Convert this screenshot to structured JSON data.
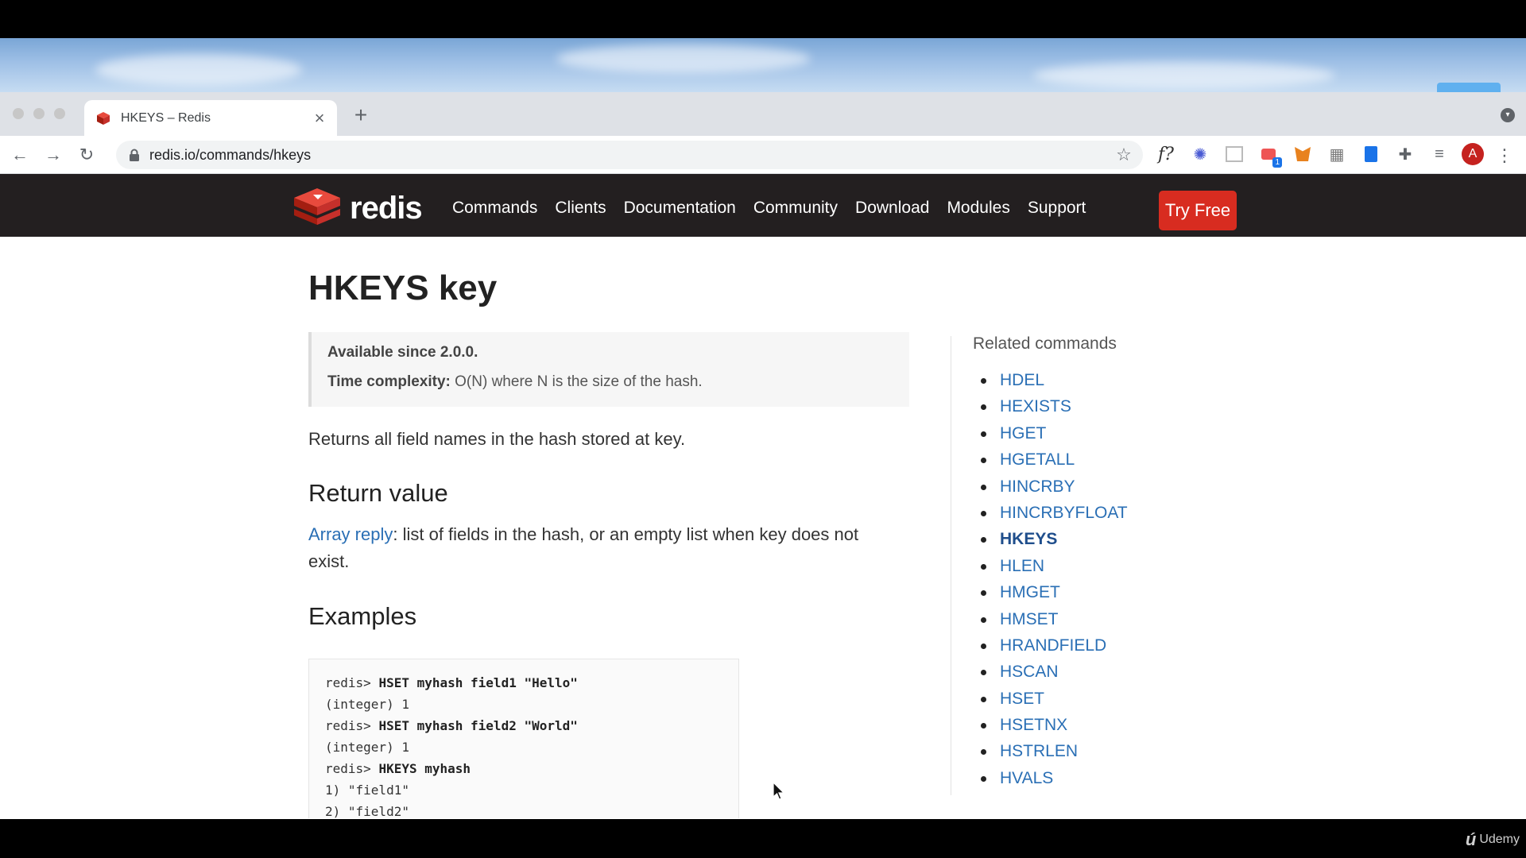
{
  "browser": {
    "tab": {
      "title": "HKEYS – Redis",
      "close_icon": "close-icon"
    },
    "url": {
      "host": "redis.io",
      "path": "/commands/hkeys"
    },
    "extensions": [
      {
        "name": "fx-icon",
        "label": "f?"
      },
      {
        "name": "snowflake-icon",
        "label": "✱"
      },
      {
        "name": "screen-icon",
        "label": ""
      },
      {
        "name": "tabs-icon",
        "label": "",
        "badge": "1"
      },
      {
        "name": "fox-icon",
        "label": ""
      },
      {
        "name": "grid-icon",
        "label": ""
      },
      {
        "name": "book-icon",
        "label": ""
      },
      {
        "name": "puzzle-icon",
        "label": ""
      },
      {
        "name": "playlist-icon",
        "label": ""
      }
    ],
    "avatar_letter": "A"
  },
  "site": {
    "logo_text": "redis",
    "nav": [
      "Commands",
      "Clients",
      "Documentation",
      "Community",
      "Download",
      "Modules",
      "Support"
    ],
    "cta": "Try Free",
    "brand_color": "#d82c20"
  },
  "doc": {
    "title": "HKEYS key",
    "since": "Available since 2.0.0.",
    "complexity_label": "Time complexity:",
    "complexity_value": " O(N) where N is the size of the hash.",
    "summary": "Returns all field names in the hash stored at key.",
    "return_heading": "Return value",
    "return_link": "Array reply",
    "return_text": ": list of fields in the hash, or an empty list when key does not exist.",
    "examples_heading": "Examples",
    "code": [
      {
        "prompt": "redis> ",
        "cmd": "HSET myhash field1 \"Hello\"",
        "out": ""
      },
      {
        "prompt": "",
        "cmd": "",
        "out": "(integer) 1"
      },
      {
        "prompt": "redis> ",
        "cmd": "HSET myhash field2 \"World\"",
        "out": ""
      },
      {
        "prompt": "",
        "cmd": "",
        "out": "(integer) 1"
      },
      {
        "prompt": "redis> ",
        "cmd": "HKEYS myhash",
        "out": ""
      },
      {
        "prompt": "",
        "cmd": "",
        "out": "1) \"field1\""
      },
      {
        "prompt": "",
        "cmd": "",
        "out": "2) \"field2\""
      }
    ]
  },
  "related": {
    "heading": "Related commands",
    "items": [
      "HDEL",
      "HEXISTS",
      "HGET",
      "HGETALL",
      "HINCRBY",
      "HINCRBYFLOAT",
      "HKEYS",
      "HLEN",
      "HMGET",
      "HMSET",
      "HRANDFIELD",
      "HSCAN",
      "HSET",
      "HSETNX",
      "HSTRLEN",
      "HVALS"
    ],
    "current": "HKEYS"
  },
  "overlay": {
    "watermark": "Udemy"
  }
}
